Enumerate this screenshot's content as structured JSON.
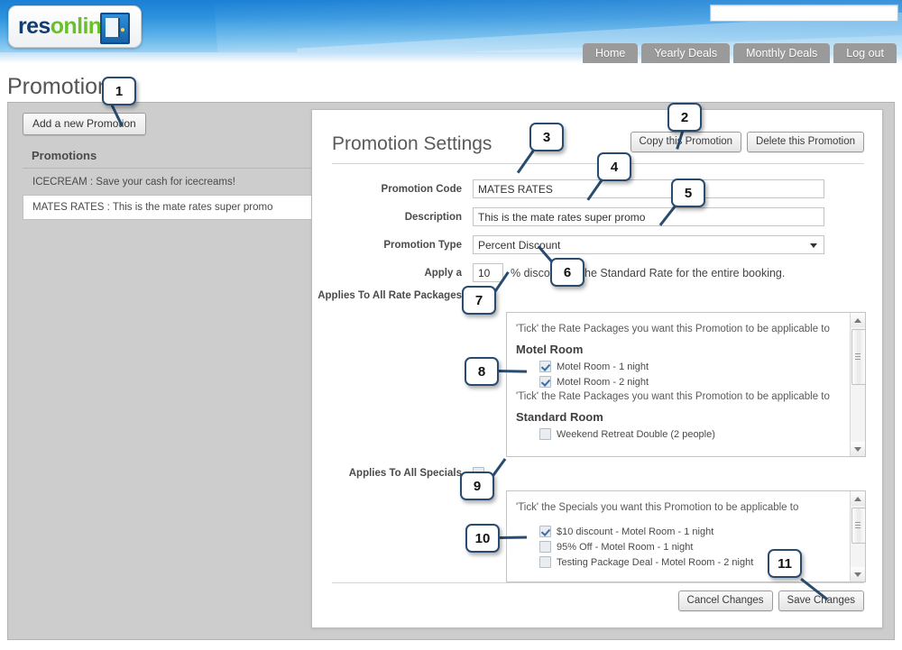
{
  "header": {
    "logo": {
      "part1": "res",
      "part2": "online",
      "icon": "door-exit-icon"
    },
    "search_value": "",
    "search_placeholder": "",
    "nav": [
      {
        "label": "Home"
      },
      {
        "label": "Yearly Deals"
      },
      {
        "label": "Monthly Deals"
      },
      {
        "label": "Log out"
      }
    ]
  },
  "page": {
    "title": "Promotions"
  },
  "sidebar": {
    "add_button": "Add a new Promotion",
    "list_header": "Promotions",
    "items": [
      {
        "label": "ICECREAM : Save your cash for icecreams!",
        "selected": false
      },
      {
        "label": "MATES RATES : This is the mate rates super promo",
        "selected": true
      }
    ]
  },
  "settings": {
    "title": "Promotion Settings",
    "copy_button": "Copy this Promotion",
    "delete_button": "Delete this Promotion",
    "fields": {
      "promotion_code_label": "Promotion Code",
      "promotion_code_value": "MATES RATES",
      "description_label": "Description",
      "description_value": "This is the mate rates super promo",
      "promotion_type_label": "Promotion Type",
      "promotion_type_value": "Percent Discount",
      "apply_label": "Apply a",
      "apply_value": "10",
      "apply_suffix": "% discount to the Standard Rate for the entire booking."
    },
    "rate_packages": {
      "all_label": "Applies To All Rate Packages",
      "all_checked": false,
      "note1": "'Tick' the Rate Packages you want this Promotion to be applicable to",
      "group1": "Motel Room",
      "group1_options": [
        {
          "label": "Motel Room - 1 night",
          "checked": true
        },
        {
          "label": "Motel Room - 2 night",
          "checked": true
        }
      ],
      "note2": "'Tick' the Rate Packages you want this Promotion to be applicable to",
      "group2": "Standard Room",
      "group2_options": [
        {
          "label": "Weekend Retreat Double (2 people)",
          "checked": false
        }
      ]
    },
    "specials": {
      "all_label": "Applies To All Specials",
      "all_checked": false,
      "note": "'Tick' the Specials you want this Promotion to be applicable to",
      "options": [
        {
          "label": "$10 discount - Motel Room - 1 night",
          "checked": true
        },
        {
          "label": "95% Off - Motel Room - 1 night",
          "checked": false
        },
        {
          "label": "Testing Package Deal - Motel Room - 2 night",
          "checked": false
        }
      ]
    },
    "cancel_button": "Cancel Changes",
    "save_button": "Save Changes"
  },
  "callouts": [
    {
      "n": "1"
    },
    {
      "n": "2"
    },
    {
      "n": "3"
    },
    {
      "n": "4"
    },
    {
      "n": "5"
    },
    {
      "n": "6"
    },
    {
      "n": "7"
    },
    {
      "n": "8"
    },
    {
      "n": "9"
    },
    {
      "n": "10"
    },
    {
      "n": "11"
    }
  ],
  "colors": {
    "accent": "#1b7fd4",
    "callout_border": "#284b70",
    "logo_green": "#6bbf2a",
    "logo_navy": "#123d6e"
  }
}
